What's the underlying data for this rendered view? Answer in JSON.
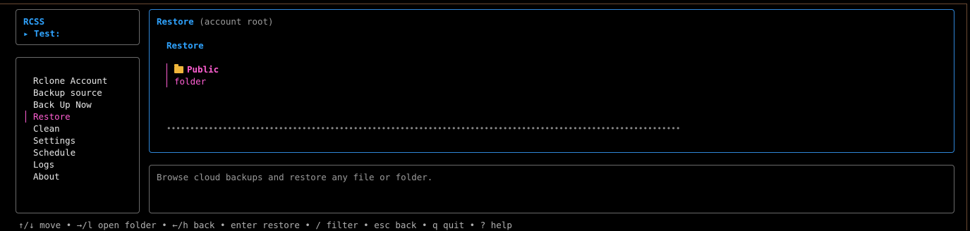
{
  "brand": {
    "title": "RCSS",
    "account": "▸ Test:"
  },
  "nav": {
    "items": [
      {
        "label": "Rclone Account"
      },
      {
        "label": "Backup source"
      },
      {
        "label": "Back Up Now"
      },
      {
        "label": "Restore",
        "selected": true
      },
      {
        "label": "Clean"
      },
      {
        "label": "Settings"
      },
      {
        "label": "Schedule"
      },
      {
        "label": "Logs"
      },
      {
        "label": "About"
      }
    ]
  },
  "main": {
    "header_title": "Restore",
    "header_sub": "(account root)",
    "section_title": "Restore",
    "entries": [
      {
        "name": "Public",
        "type": "folder",
        "icon": "folder-icon"
      }
    ],
    "progress_dots": "••••••••••••••••••••••••••••••••••••••••••••••••••••••••••••••••••••••••••••••••••••••••••••••••••••••••••••••"
  },
  "status": {
    "text": "Browse cloud backups and restore any file or folder."
  },
  "help": {
    "text": "↑/↓ move • →/l open folder • ←/h back • enter restore • / filter • esc back • q quit • ? help"
  },
  "colors": {
    "accent_blue": "#2fa3ff",
    "selected_pink": "#ff5fd2",
    "folder_yellow": "#f0b63a"
  }
}
